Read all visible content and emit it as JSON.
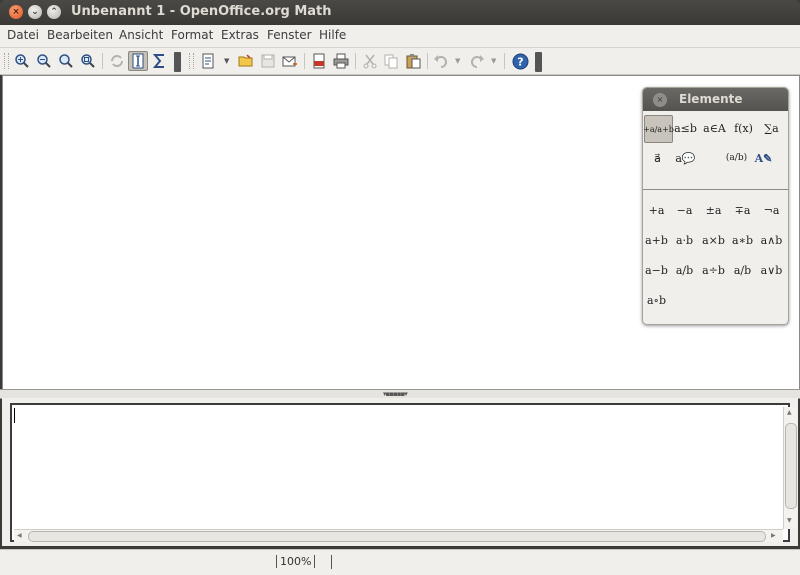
{
  "window": {
    "title": "Unbenannt 1 - OpenOffice.org Math",
    "controls": {
      "close": "×",
      "minimize": "⌄",
      "maximize": "⌃"
    }
  },
  "menubar": {
    "items": [
      "Datei",
      "Bearbeiten",
      "Ansicht",
      "Format",
      "Extras",
      "Fenster",
      "Hilfe"
    ]
  },
  "toolbar": {
    "buttons": [
      {
        "name": "zoom-in-icon",
        "glyph": "🔍"
      },
      {
        "name": "zoom-out-icon",
        "glyph": "🔍"
      },
      {
        "name": "zoom-100-icon",
        "glyph": "🔍"
      },
      {
        "name": "zoom-page-icon",
        "glyph": "🔍"
      },
      {
        "name": "update-icon",
        "glyph": "⟳"
      },
      {
        "name": "formula-cursor-icon",
        "glyph": "I"
      },
      {
        "name": "elements-sigma-icon",
        "glyph": "Σ"
      },
      {
        "name": "new-document-icon",
        "glyph": "▤"
      },
      {
        "name": "open-folder-icon",
        "glyph": "📂"
      },
      {
        "name": "save-icon",
        "glyph": "▣"
      },
      {
        "name": "email-icon",
        "glyph": "✉"
      },
      {
        "name": "export-pdf-icon",
        "glyph": "▤"
      },
      {
        "name": "print-icon",
        "glyph": "⎙"
      },
      {
        "name": "cut-icon",
        "glyph": "✂"
      },
      {
        "name": "copy-icon",
        "glyph": "❐"
      },
      {
        "name": "paste-icon",
        "glyph": "📋"
      },
      {
        "name": "undo-icon",
        "glyph": "↶"
      },
      {
        "name": "redo-icon",
        "glyph": "↷"
      },
      {
        "name": "help-icon",
        "glyph": "?"
      }
    ]
  },
  "status": {
    "zoom": "100%"
  },
  "elements_panel": {
    "title": "Elemente",
    "close_glyph": "×",
    "categories": [
      {
        "name": "category-unary-binary",
        "label": "+a/a+b"
      },
      {
        "name": "category-relations",
        "label": "a≤b"
      },
      {
        "name": "category-set-operations",
        "label": "a∈A"
      },
      {
        "name": "category-functions",
        "label": "f(x)"
      },
      {
        "name": "category-operators",
        "label": "∑a"
      },
      {
        "name": "category-attributes",
        "label": "a⃗"
      },
      {
        "name": "category-others",
        "label": "a💬"
      },
      {
        "name": "category-brackets",
        "label": "(a/b)"
      },
      {
        "name": "category-formats",
        "label": "A✎"
      }
    ],
    "operators": [
      "+a",
      "−a",
      "±a",
      "∓a",
      "¬a",
      "a+b",
      "a·b",
      "a×b",
      "a∗b",
      "a∧b",
      "a−b",
      "a/b",
      "a÷b",
      "a/b",
      "a∨b",
      "a∘b"
    ]
  }
}
